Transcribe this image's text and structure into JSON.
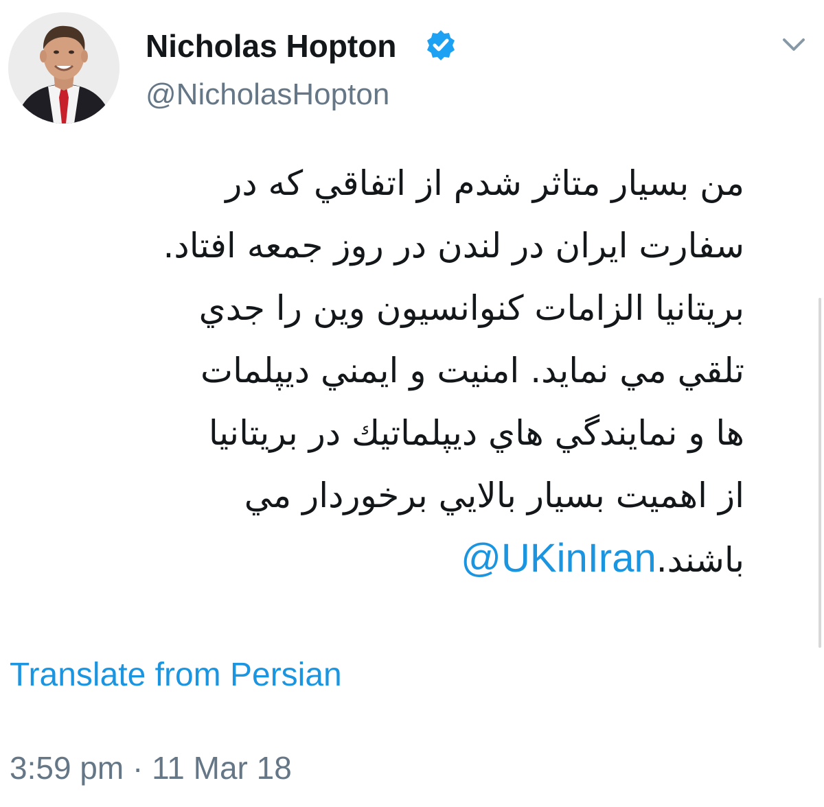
{
  "author": {
    "display_name": "Nicholas Hopton",
    "handle": "@NicholasHopton",
    "verified": true,
    "avatar_icon": "profile-photo",
    "verified_icon": "verified-badge-icon",
    "verified_color": "#1da1f2"
  },
  "menu": {
    "icon": "chevron-down-icon"
  },
  "tweet": {
    "lines": [
      "من بسيار متاثر شدم از اتفاقي كه در",
      "سفارت ايران در لندن در روز جمعه افتاد.",
      "بريتانيا الزامات كنوانسيون وين را جدي",
      "تلقي مي نمايد. امنيت و ايمني ديپلمات",
      "ها و نمايندگي هاي ديپلماتيك در بريتانيا",
      "از اهميت بسيار بالايي برخوردار مي"
    ],
    "last_line_text": "باشند.",
    "mention": "@UKinIran"
  },
  "translate_label": "Translate from Persian",
  "timestamp": "3:59 pm · 11 Mar 18",
  "colors": {
    "link": "#1b95e0",
    "secondary": "#657786",
    "primary_text": "#14171a"
  }
}
